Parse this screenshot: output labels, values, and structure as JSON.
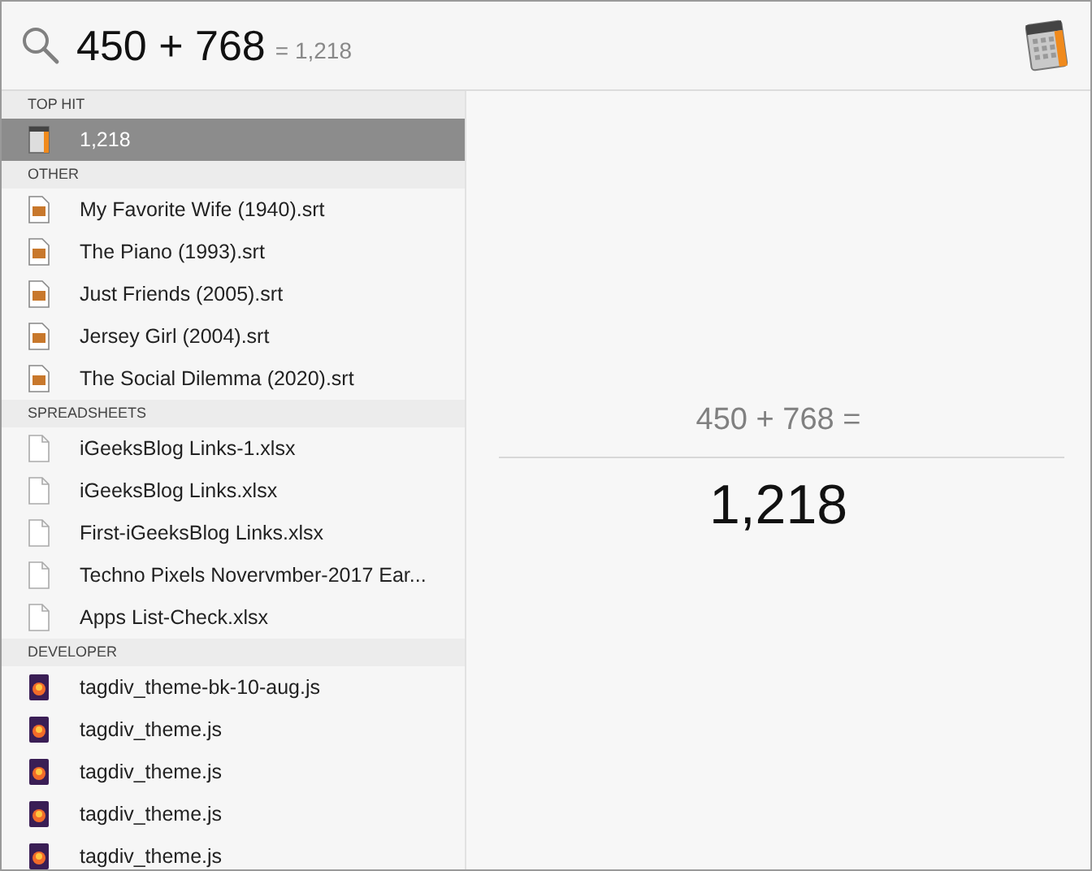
{
  "search": {
    "query": "450 + 768",
    "inline_result": "= 1,218"
  },
  "sections": [
    {
      "title": "TOP HIT",
      "items": [
        {
          "label": "1,218",
          "kind": "calc",
          "selected": true
        }
      ]
    },
    {
      "title": "OTHER",
      "items": [
        {
          "label": "My Favorite Wife (1940).srt",
          "kind": "srt",
          "selected": false
        },
        {
          "label": "The Piano (1993).srt",
          "kind": "srt",
          "selected": false
        },
        {
          "label": "Just Friends (2005).srt",
          "kind": "srt",
          "selected": false
        },
        {
          "label": "Jersey Girl (2004).srt",
          "kind": "srt",
          "selected": false
        },
        {
          "label": "The Social Dilemma (2020).srt",
          "kind": "srt",
          "selected": false
        }
      ]
    },
    {
      "title": "SPREADSHEETS",
      "items": [
        {
          "label": "iGeeksBlog Links-1.xlsx",
          "kind": "sheet",
          "selected": false
        },
        {
          "label": "iGeeksBlog Links.xlsx",
          "kind": "sheet",
          "selected": false
        },
        {
          "label": "First-iGeeksBlog Links.xlsx",
          "kind": "sheet",
          "selected": false
        },
        {
          "label": "Techno Pixels Novervmber-2017 Ear...",
          "kind": "sheet",
          "selected": false
        },
        {
          "label": "Apps List-Check.xlsx",
          "kind": "sheet",
          "selected": false
        }
      ]
    },
    {
      "title": "DEVELOPER",
      "items": [
        {
          "label": "tagdiv_theme-bk-10-aug.js",
          "kind": "js",
          "selected": false
        },
        {
          "label": "tagdiv_theme.js",
          "kind": "js",
          "selected": false
        },
        {
          "label": "tagdiv_theme.js",
          "kind": "js",
          "selected": false
        },
        {
          "label": "tagdiv_theme.js",
          "kind": "js",
          "selected": false
        },
        {
          "label": "tagdiv_theme.js",
          "kind": "js",
          "selected": false
        }
      ]
    }
  ],
  "preview": {
    "expression": "450 + 768 =",
    "result": "1,218"
  }
}
